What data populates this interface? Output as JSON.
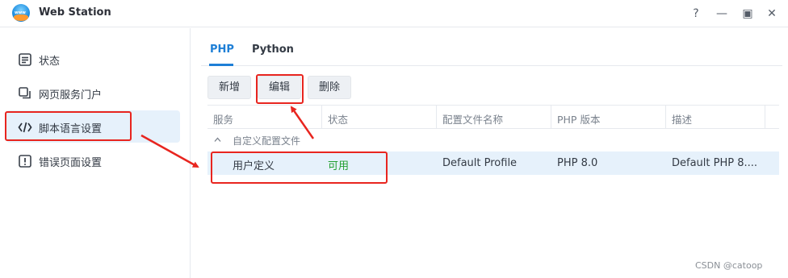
{
  "window": {
    "title": "Web Station",
    "controls": [
      "?",
      "—",
      "▣",
      "✕"
    ]
  },
  "sidebar": {
    "items": [
      {
        "label": "状态",
        "icon": "status-icon"
      },
      {
        "label": "网页服务门户",
        "icon": "web-portal-icon"
      },
      {
        "label": "脚本语言设置",
        "icon": "code-icon",
        "selected": true
      },
      {
        "label": "错误页面设置",
        "icon": "error-page-icon"
      }
    ]
  },
  "tabs": [
    {
      "label": "PHP",
      "active": true
    },
    {
      "label": "Python",
      "active": false
    }
  ],
  "toolbar": {
    "add_label": "新增",
    "edit_label": "编辑",
    "delete_label": "删除"
  },
  "table": {
    "columns": [
      "服务",
      "状态",
      "配置文件名称",
      "PHP 版本",
      "描述"
    ],
    "group_label": "自定义配置文件",
    "rows": [
      {
        "service": "用户定义",
        "status": "可用",
        "profile": "Default Profile",
        "version": "PHP 8.0",
        "description": "Default PHP 8...."
      }
    ]
  },
  "colors": {
    "accent": "#1e7fd6",
    "selected_bg": "#e6f1fb",
    "status_ok": "#23a032",
    "annotation": "#e8251f"
  },
  "watermark": "CSDN @catoop"
}
